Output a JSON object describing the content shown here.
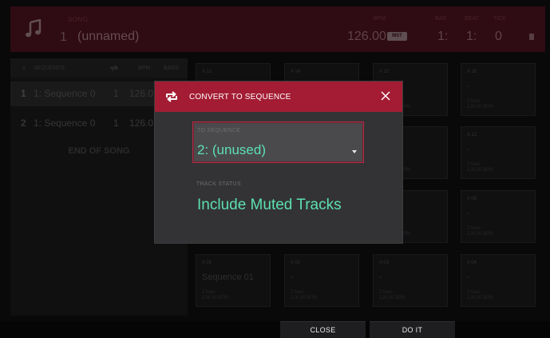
{
  "header": {
    "song_label": "SONG",
    "song_number": "1",
    "song_name": "(unnamed)",
    "bpm_label": "BPM",
    "bpm_value": "126.00",
    "tempo_source": "MST",
    "bar_label": "BAR",
    "bar_value": "1:",
    "beat_label": "BEAT",
    "beat_value": "1:",
    "tick_label": "TICK",
    "tick_value": "0"
  },
  "sequence_list": {
    "columns": {
      "num": "#",
      "sequence": "SEQUENCE",
      "bpm": "BPM",
      "bars": "BARS"
    },
    "rows": [
      {
        "num": "1",
        "name": "1: Sequence 0",
        "loop": "1",
        "bpm": "126.0"
      },
      {
        "num": "2",
        "name": "1: Sequence 0",
        "loop": "1",
        "bpm": "126.0"
      }
    ],
    "end_label": "END OF SONG"
  },
  "pads": [
    {
      "id": "A 13",
      "name": "",
      "bars": "",
      "bpm": ""
    },
    {
      "id": "A 14",
      "name": "",
      "bars": "",
      "bpm": ""
    },
    {
      "id": "A 15",
      "name": "",
      "bars": "",
      "bpm": "PM"
    },
    {
      "id": "A 16",
      "name": "-",
      "bars": "2 bars",
      "bpm": "126.00 BPM"
    },
    {
      "id": "",
      "name": "",
      "bars": "",
      "bpm": "PM"
    },
    {
      "id": "A 12",
      "name": "-",
      "bars": "2 bars",
      "bpm": "126.00 BPM"
    },
    {
      "id": "",
      "name": "",
      "bars": "",
      "bpm": "PM"
    },
    {
      "id": "A 08",
      "name": "-",
      "bars": "2 bars",
      "bpm": "126.00 BPM"
    },
    {
      "id": "A 01",
      "name": "Sequence 01",
      "bars": "2 bars",
      "bpm": "126.00 BPM"
    },
    {
      "id": "A 02",
      "name": "-",
      "bars": "2 bars",
      "bpm": "126.00 BPM"
    },
    {
      "id": "A 03",
      "name": "-",
      "bars": "2 bars",
      "bpm": "126.00 BPM"
    },
    {
      "id": "A 04",
      "name": "-",
      "bars": "2 bars",
      "bpm": "126.00 BPM"
    }
  ],
  "dialog": {
    "title": "CONVERT TO SEQUENCE",
    "to_sequence_label": "TO SEQUENCE",
    "to_sequence_value": "2: (unused)",
    "track_status_label": "TRACK STATUS",
    "track_status_value": "Include Muted Tracks"
  },
  "footer": {
    "close_label": "CLOSE",
    "do_it_label": "DO IT"
  },
  "colors": {
    "accent": "#a31c33",
    "value_green": "#5ce0b0",
    "dialog_bg": "#333335",
    "header_bg": "#4c1320"
  },
  "icons": [
    "music-note-icon",
    "loop-icon",
    "close-icon",
    "dropdown-caret-icon",
    "stop-icon"
  ]
}
